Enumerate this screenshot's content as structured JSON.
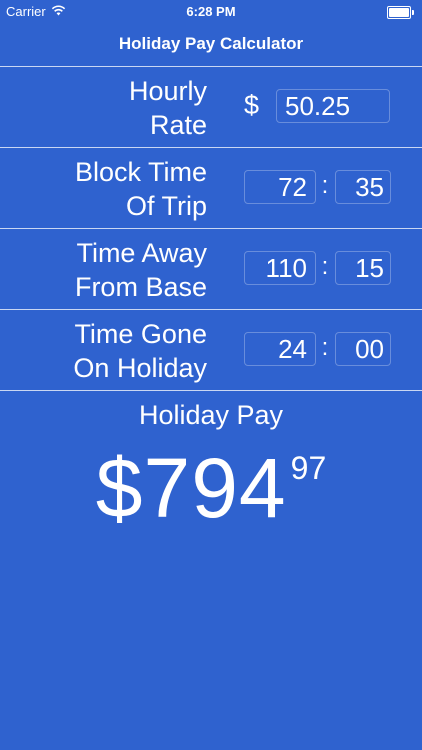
{
  "status_bar": {
    "carrier": "Carrier",
    "time": "6:28 PM",
    "wifi_icon": "wifi-icon",
    "battery_icon": "battery-icon",
    "battery_level": 1.0
  },
  "nav": {
    "title": "Holiday Pay Calculator"
  },
  "rows": {
    "hourly_rate": {
      "label": "Hourly\nRate",
      "currency": "$",
      "value": "50.25"
    },
    "block_time": {
      "label": "Block Time\nOf Trip",
      "hours": "72",
      "separator": ":",
      "minutes": "35"
    },
    "time_away": {
      "label": "Time Away\nFrom Base",
      "hours": "110",
      "separator": ":",
      "minutes": "15"
    },
    "time_holiday": {
      "label": "Time Gone\nOn Holiday",
      "hours": "24",
      "separator": ":",
      "minutes": "00"
    }
  },
  "result": {
    "title": "Holiday Pay",
    "amount": "$794",
    "cents": "97"
  },
  "colors": {
    "background": "#2f62cf",
    "text": "#ffffff"
  }
}
